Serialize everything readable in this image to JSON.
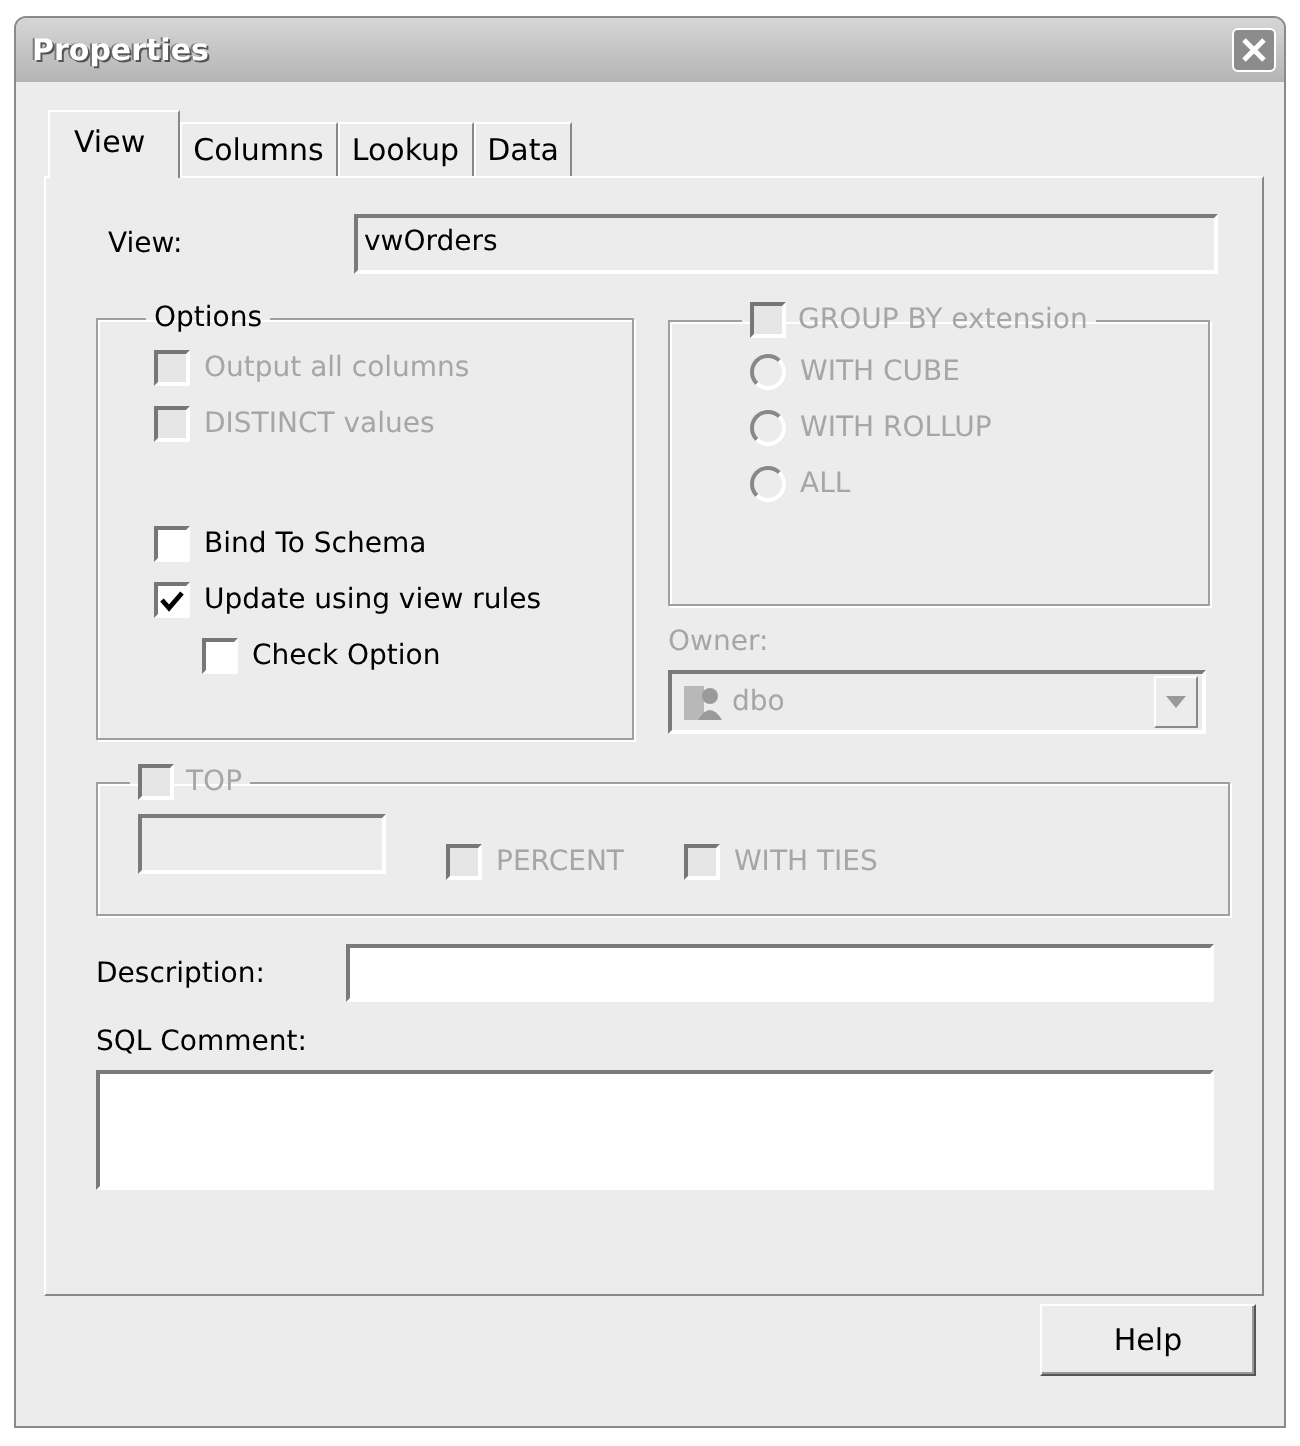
{
  "window": {
    "title": "Properties"
  },
  "tabs": [
    {
      "label": "View",
      "selected": true
    },
    {
      "label": "Columns",
      "selected": false
    },
    {
      "label": "Lookup",
      "selected": false
    },
    {
      "label": "Data",
      "selected": false
    }
  ],
  "view": {
    "label": "View:",
    "value": "vwOrders"
  },
  "options": {
    "title": "Options",
    "sections": [
      {
        "items": [
          {
            "label": "Output all columns",
            "checked": false,
            "disabled": true,
            "indented": false
          },
          {
            "label": "DISTINCT values",
            "checked": false,
            "disabled": true,
            "indented": false
          }
        ]
      },
      {
        "items": [
          {
            "label": "Bind To Schema",
            "checked": false,
            "disabled": false,
            "indented": false
          },
          {
            "label": "Update using view rules",
            "checked": true,
            "disabled": false,
            "indented": false
          },
          {
            "label": "Check Option",
            "checked": false,
            "disabled": false,
            "indented": true
          }
        ]
      }
    ]
  },
  "group_by": {
    "label": "GROUP BY extension",
    "checked": false,
    "disabled": true,
    "options": [
      {
        "label": "WITH CUBE",
        "selected": false,
        "disabled": true
      },
      {
        "label": "WITH ROLLUP",
        "selected": false,
        "disabled": true
      },
      {
        "label": "ALL",
        "selected": false,
        "disabled": true
      }
    ]
  },
  "owner": {
    "label": "Owner:",
    "value": "dbo",
    "disabled": true
  },
  "top": {
    "label": "TOP",
    "checked": false,
    "disabled": true,
    "checks": [
      {
        "label": "PERCENT",
        "checked": false,
        "disabled": true
      },
      {
        "label": "WITH TIES",
        "checked": false,
        "disabled": true
      }
    ]
  },
  "description": {
    "label": "Description:"
  },
  "sql_comment": {
    "label": "SQL Comment:"
  },
  "buttons": [
    {
      "label": "Help"
    }
  ]
}
